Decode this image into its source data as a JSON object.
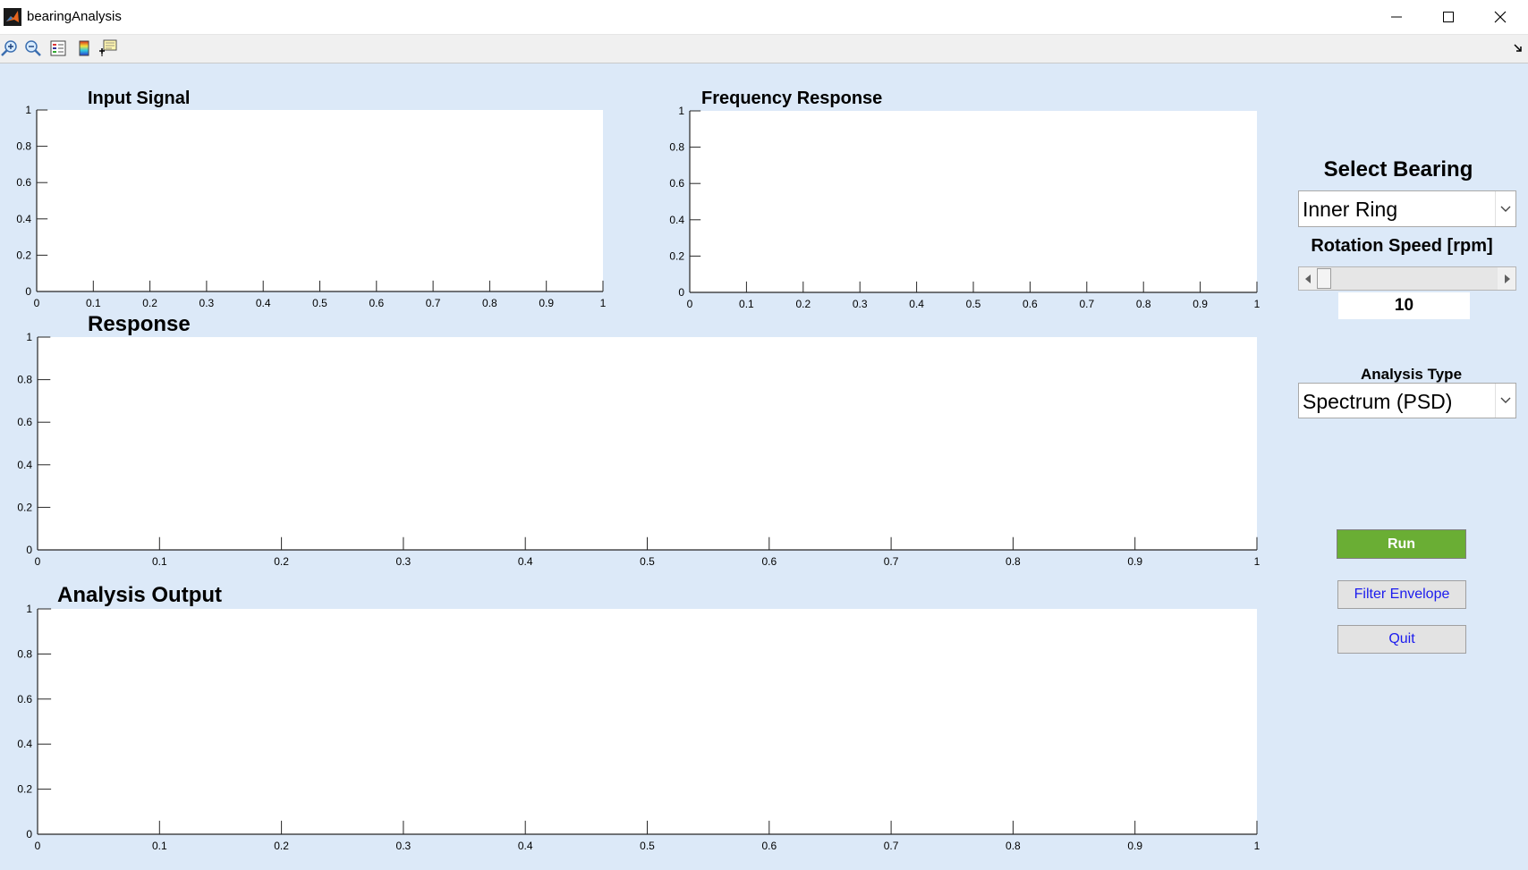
{
  "window": {
    "title": "bearingAnalysis",
    "controls": [
      "minimize-icon",
      "maximize-icon",
      "close-icon"
    ]
  },
  "toolbar": {
    "icons": [
      "zoom-in-icon",
      "zoom-out-icon",
      "insert-legend-icon",
      "insert-colorbar-icon",
      "data-cursor-icon"
    ]
  },
  "axes": {
    "input_signal": {
      "title": "Input Signal",
      "x_ticks": [
        "0",
        "0.1",
        "0.2",
        "0.3",
        "0.4",
        "0.5",
        "0.6",
        "0.7",
        "0.8",
        "0.9",
        "1"
      ],
      "y_ticks": [
        "0",
        "0.2",
        "0.4",
        "0.6",
        "0.8",
        "1"
      ]
    },
    "frequency_response": {
      "title": "Frequency Response",
      "x_ticks": [
        "0",
        "0.1",
        "0.2",
        "0.3",
        "0.4",
        "0.5",
        "0.6",
        "0.7",
        "0.8",
        "0.9",
        "1"
      ],
      "y_ticks": [
        "0",
        "0.2",
        "0.4",
        "0.6",
        "0.8",
        "1"
      ]
    },
    "response": {
      "title": "Response",
      "x_ticks": [
        "0",
        "0.1",
        "0.2",
        "0.3",
        "0.4",
        "0.5",
        "0.6",
        "0.7",
        "0.8",
        "0.9",
        "1"
      ],
      "y_ticks": [
        "0",
        "0.2",
        "0.4",
        "0.6",
        "0.8",
        "1"
      ]
    },
    "analysis_output": {
      "title": "Analysis Output",
      "x_ticks": [
        "0",
        "0.1",
        "0.2",
        "0.3",
        "0.4",
        "0.5",
        "0.6",
        "0.7",
        "0.8",
        "0.9",
        "1"
      ],
      "y_ticks": [
        "0",
        "0.2",
        "0.4",
        "0.6",
        "0.8",
        "1"
      ]
    }
  },
  "controls": {
    "select_bearing_label": "Select Bearing",
    "select_bearing_value": "Inner Ring",
    "rotation_speed_label": "Rotation Speed [rpm]",
    "rotation_speed_value": "10",
    "rotation_speed_slider_fraction": 0.0,
    "analysis_type_label": "Analysis Type",
    "analysis_type_value": "Spectrum (PSD)",
    "run_label": "Run",
    "filter_envelope_label": "Filter Envelope",
    "quit_label": "Quit"
  },
  "colors": {
    "figure_bg": "#dce9f8",
    "run_button": "#6aae34",
    "button_text_blue": "#1c1cee"
  },
  "chart_data": [
    {
      "type": "line",
      "title": "Input Signal",
      "series": [],
      "xlim": [
        0,
        1
      ],
      "ylim": [
        0,
        1
      ],
      "grid": false
    },
    {
      "type": "line",
      "title": "Frequency Response",
      "series": [],
      "xlim": [
        0,
        1
      ],
      "ylim": [
        0,
        1
      ],
      "grid": false
    },
    {
      "type": "line",
      "title": "Response",
      "series": [],
      "xlim": [
        0,
        1
      ],
      "ylim": [
        0,
        1
      ],
      "grid": false
    },
    {
      "type": "line",
      "title": "Analysis Output",
      "series": [],
      "xlim": [
        0,
        1
      ],
      "ylim": [
        0,
        1
      ],
      "grid": false
    }
  ]
}
